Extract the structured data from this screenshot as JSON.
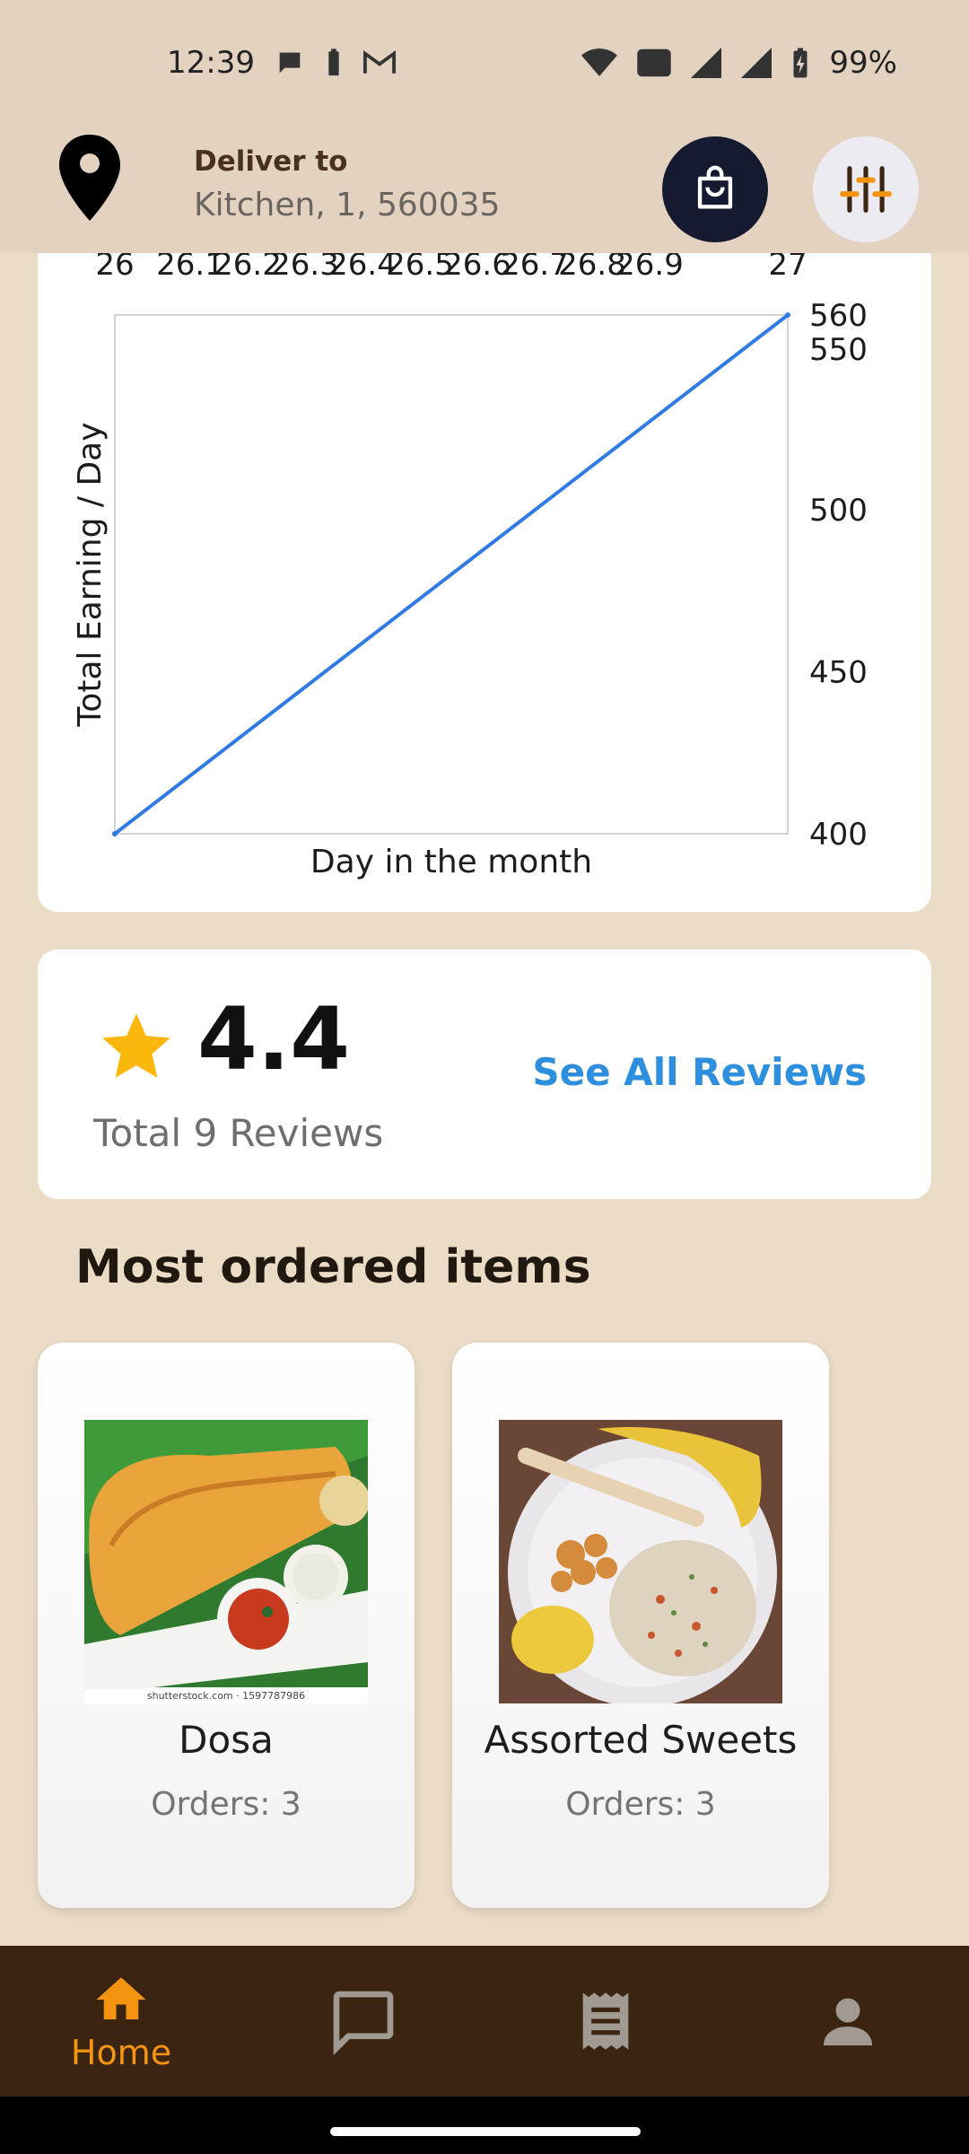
{
  "status_bar": {
    "time": "12:39",
    "battery": "99%"
  },
  "header": {
    "deliver_label": "Deliver to",
    "address": "Kitchen, 1, 560035"
  },
  "chart_data": {
    "type": "line",
    "x": [
      26,
      27
    ],
    "series": [
      {
        "values": [
          400,
          560
        ]
      }
    ],
    "xticks": [
      "26",
      "26.1",
      "26.2",
      "26.3",
      "26.4",
      "26.5",
      "26.6",
      "26.7",
      "26.8",
      "26.9",
      "27"
    ],
    "yticks": [
      "400",
      "450",
      "500",
      "550",
      "560"
    ],
    "xlim": [
      26,
      27
    ],
    "ylim": [
      400,
      560
    ],
    "xlabel": "Day in the month",
    "ylabel": "Total Earning / Day",
    "line_color": "#2f7ae5",
    "x_axis_position": "top",
    "y_axis_position": "right"
  },
  "reviews": {
    "rating": "4.4",
    "total": "Total 9 Reviews",
    "see_all": "See All Reviews",
    "star_color": "#fbb70c"
  },
  "most_ordered": {
    "title": "Most ordered items",
    "items": [
      {
        "name": "Dosa",
        "orders": "Orders: 3",
        "watermark": "shutterstock.com · 1597787986"
      },
      {
        "name": "Assorted Sweets",
        "orders": "Orders: 3"
      }
    ]
  },
  "nav": {
    "items": [
      {
        "icon": "home-icon",
        "label": "Home",
        "active": true
      },
      {
        "icon": "chat-icon"
      },
      {
        "icon": "receipt-icon"
      },
      {
        "icon": "profile-icon"
      }
    ],
    "active_color": "#f59410",
    "inactive_color": "#a09a93"
  }
}
